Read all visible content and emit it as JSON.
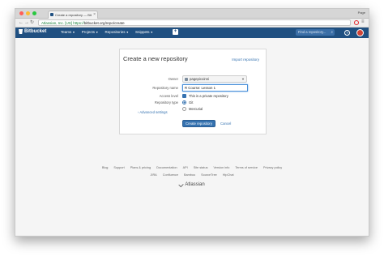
{
  "browser": {
    "tab_title": "Create a repository — Bit",
    "page_label": "Page",
    "url_secure": "Atlassian, Inc. [US]",
    "url_scheme": "https://",
    "url_host": "bitbucket.org",
    "url_path": "/repo/create"
  },
  "nav": {
    "logo_text": "Bitbucket",
    "menu": [
      "Teams",
      "Projects",
      "Repositories",
      "Snippets"
    ],
    "plus_label": "+",
    "search_placeholder": "Find a repository...",
    "help_label": "?"
  },
  "form": {
    "title": "Create a new repository",
    "import_link": "Import repository",
    "owner_label": "Owner",
    "owner_value": "pagepicoinni",
    "repo_name_label": "Repository name",
    "repo_name_value": "R Course: Lesson 1",
    "access_label": "Access level",
    "private_label": "This is a private repository",
    "type_label": "Repository type",
    "type_git": "Git",
    "type_mercurial": "Mercurial",
    "advanced": "Advanced settings",
    "create_button": "Create repository",
    "cancel": "Cancel"
  },
  "footer": {
    "row1": [
      "Blog",
      "Support",
      "Plans & pricing",
      "Documentation",
      "API",
      "Site status",
      "Version info",
      "Terms of service",
      "Privacy policy"
    ],
    "row2": [
      "JIRA",
      "Confluence",
      "Bamboo",
      "SourceTree",
      "HipChat"
    ],
    "brand": "Atlassian"
  },
  "colors": {
    "nav_bg": "#205081",
    "link": "#3572b0",
    "primary_button": "#3572b0"
  }
}
